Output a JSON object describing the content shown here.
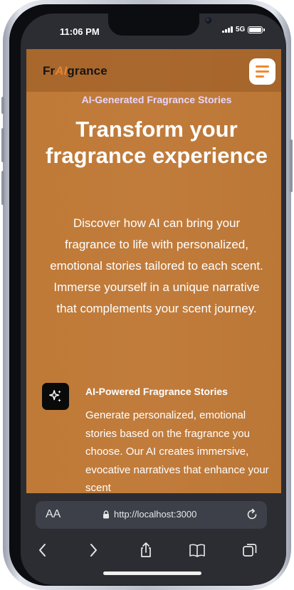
{
  "status_bar": {
    "time": "11:06 PM",
    "network": "5G"
  },
  "site": {
    "logo": {
      "before": "Fr",
      "highlight": "AI",
      "after": "grance"
    },
    "eyebrow": "AI-Generated Fragrance Stories",
    "hero_title": "Transform your fragrance experience",
    "hero_description": "Discover how AI can bring your fragrance to life with personalized, emotional stories tailored to each scent. Immerse yourself in a unique narrative that complements your scent journey.",
    "feature": {
      "icon": "sparkles-icon",
      "title": "AI-Powered Fragrance Stories",
      "description": "Generate personalized, emotional stories based on the fragrance you choose. Our AI creates immersive, evocative narratives that enhance your scent"
    }
  },
  "browser": {
    "text_size_label": "AA",
    "url": "http://localhost:3000",
    "icons": [
      "back-icon",
      "forward-icon",
      "share-icon",
      "bookmarks-icon",
      "tabs-icon",
      "reload-icon",
      "lock-icon",
      "menu-icon"
    ]
  },
  "colors": {
    "page_background": "#c17c3c",
    "logo_accent": "#e8822f",
    "eyebrow": "#e6d7ff",
    "menu_lines": "#f08a2e",
    "feature_icon_bg": "#0a0a0a"
  }
}
